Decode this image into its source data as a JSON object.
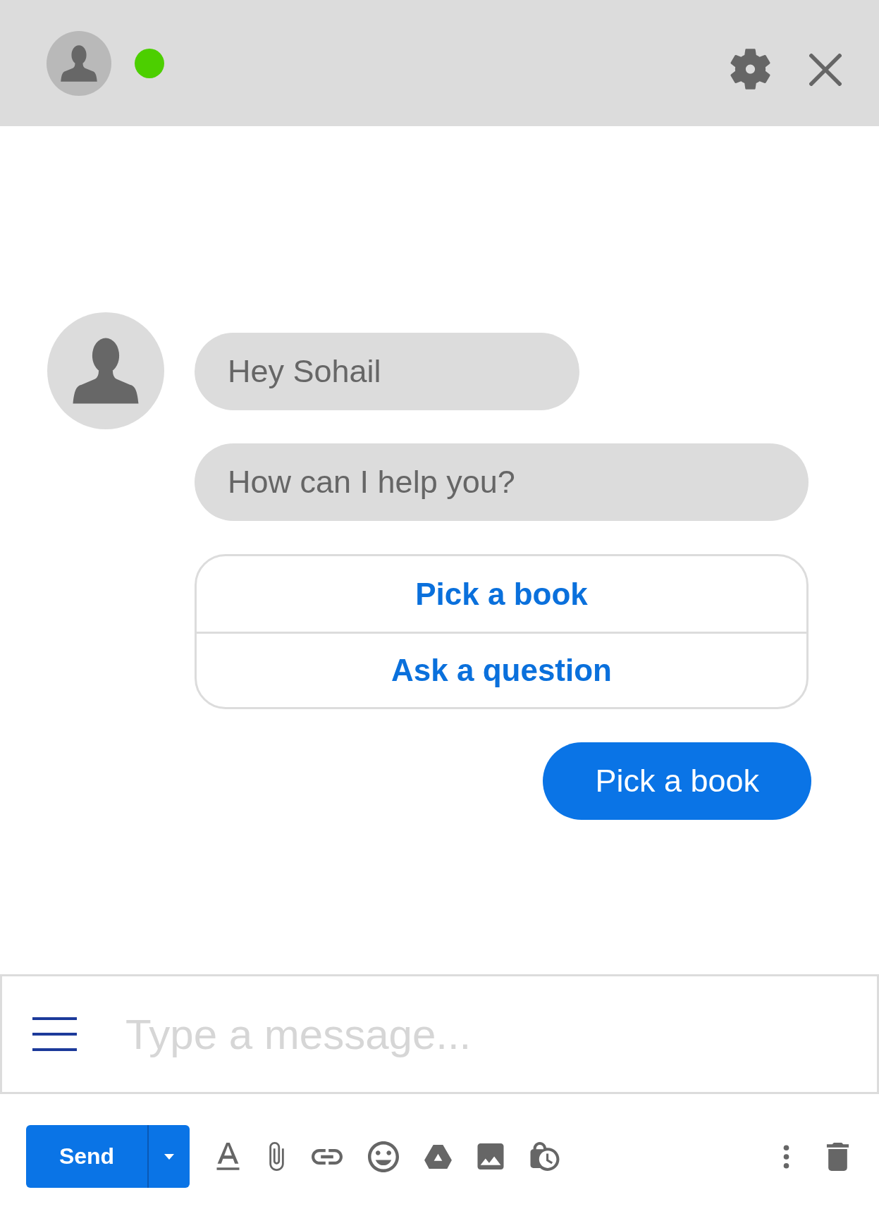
{
  "header": {
    "online": true
  },
  "conversation": [
    {
      "kind": "incoming",
      "messages": [
        "Hey Sohail",
        "How can I help you?"
      ],
      "quick_replies": [
        "Pick a book",
        "Ask a question"
      ]
    },
    {
      "kind": "outgoing",
      "messages": [
        "Pick a book"
      ]
    }
  ],
  "composer": {
    "placeholder": "Type a message..."
  },
  "toolbar": {
    "send_label": "Send"
  }
}
